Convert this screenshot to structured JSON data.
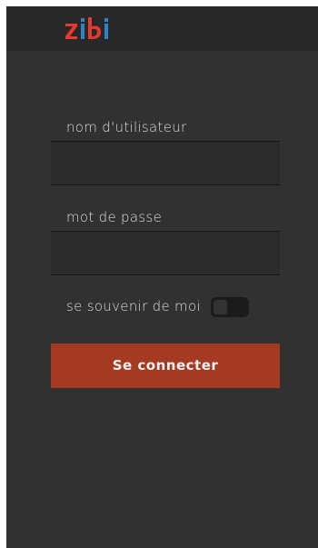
{
  "header": {
    "logo_text": "zibi",
    "logo_colors": {
      "red": "#e8392f",
      "blue": "#2b84c6"
    }
  },
  "login": {
    "username_label": "nom d'utilisateur",
    "username_value": "",
    "password_label": "mot de passe",
    "password_value": "",
    "remember_label": "se souvenir de moi",
    "remember_checked": false,
    "submit_label": "Se connecter"
  },
  "colors": {
    "background": "#313131",
    "header": "#282828",
    "field": "#2b2b2b",
    "button": "#a53a22"
  }
}
